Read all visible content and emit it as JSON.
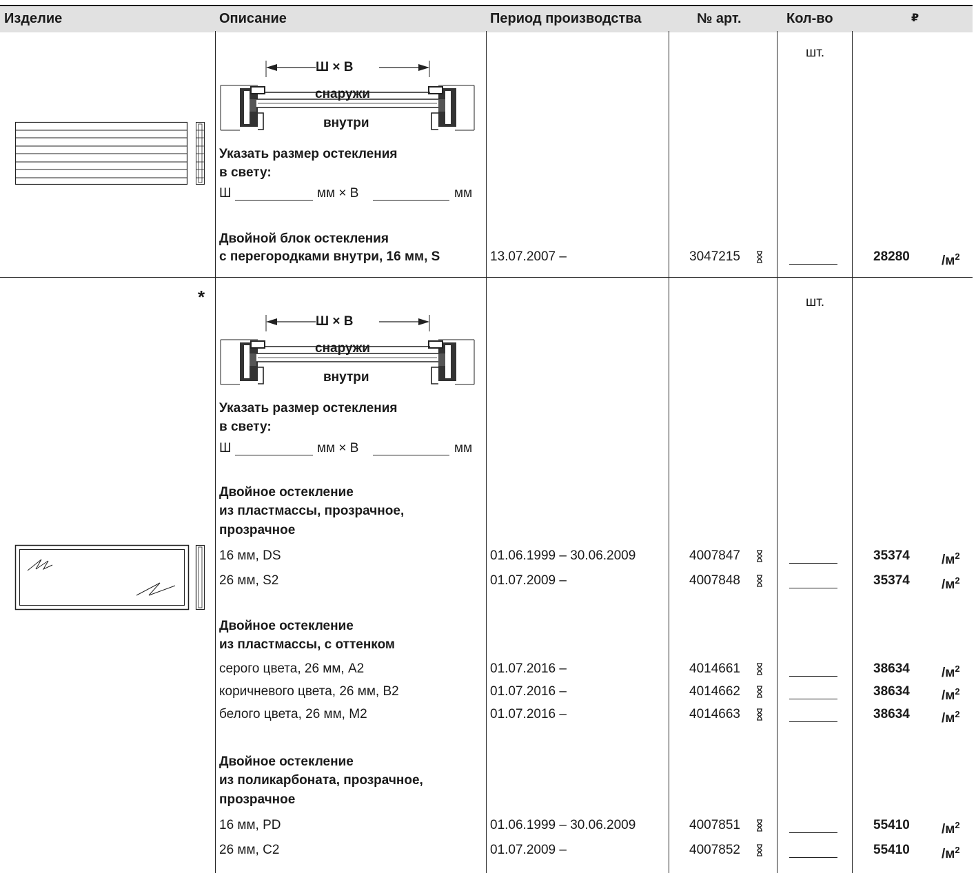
{
  "header": {
    "product": "Изделие",
    "description": "Описание",
    "period": "Период производства",
    "article": "№ арт.",
    "qty": "Кол-во",
    "price": "₽"
  },
  "diagram": {
    "dim": "Ш × В",
    "outside": "снаружи",
    "inside": "внутри"
  },
  "specify": {
    "line1": "Указать размер остекления",
    "line2": "в свету:",
    "w": "Ш",
    "mm_x_h": "мм × В",
    "mm": "мм"
  },
  "qty_unit": "шт.",
  "unit_main": "/м",
  "unit_sup": "2",
  "star": "*",
  "section1": {
    "title_line1": "Двойной блок остекления",
    "title_line2": "с перегородками внутри, 16 мм, S",
    "period": "13.07.2007 –",
    "article": "3047215",
    "price": "28280"
  },
  "group_a": {
    "title_line1": "Двойное остекление",
    "title_line2": "из пластмассы, прозрачное,",
    "title_line3": "прозрачное",
    "rows": [
      {
        "desc": "16 мм, DS",
        "period": "01.06.1999 – 30.06.2009",
        "article": "4007847",
        "price": "35374"
      },
      {
        "desc": "26 мм, S2",
        "period": "01.07.2009 –",
        "article": "4007848",
        "price": "35374"
      }
    ]
  },
  "group_b": {
    "title_line1": "Двойное остекление",
    "title_line2": "из пластмассы, с оттенком",
    "rows": [
      {
        "desc": "серого цвета, 26 мм, A2",
        "period": "01.07.2016 –",
        "article": "4014661",
        "price": "38634"
      },
      {
        "desc": "коричневого цвета, 26 мм, B2",
        "period": "01.07.2016 –",
        "article": "4014662",
        "price": "38634"
      },
      {
        "desc": "белого цвета, 26 мм, M2",
        "period": "01.07.2016 –",
        "article": "4014663",
        "price": "38634"
      }
    ]
  },
  "group_c": {
    "title_line1": "Двойное остекление",
    "title_line2": "из поликарбоната, прозрачное,",
    "title_line3": "прозрачное",
    "rows": [
      {
        "desc": "16 мм, PD",
        "period": "01.06.1999 – 30.06.2009",
        "article": "4007851",
        "price": "55410"
      },
      {
        "desc": "26 мм, C2",
        "period": "01.07.2009 –",
        "article": "4007852",
        "price": "55410"
      }
    ]
  }
}
